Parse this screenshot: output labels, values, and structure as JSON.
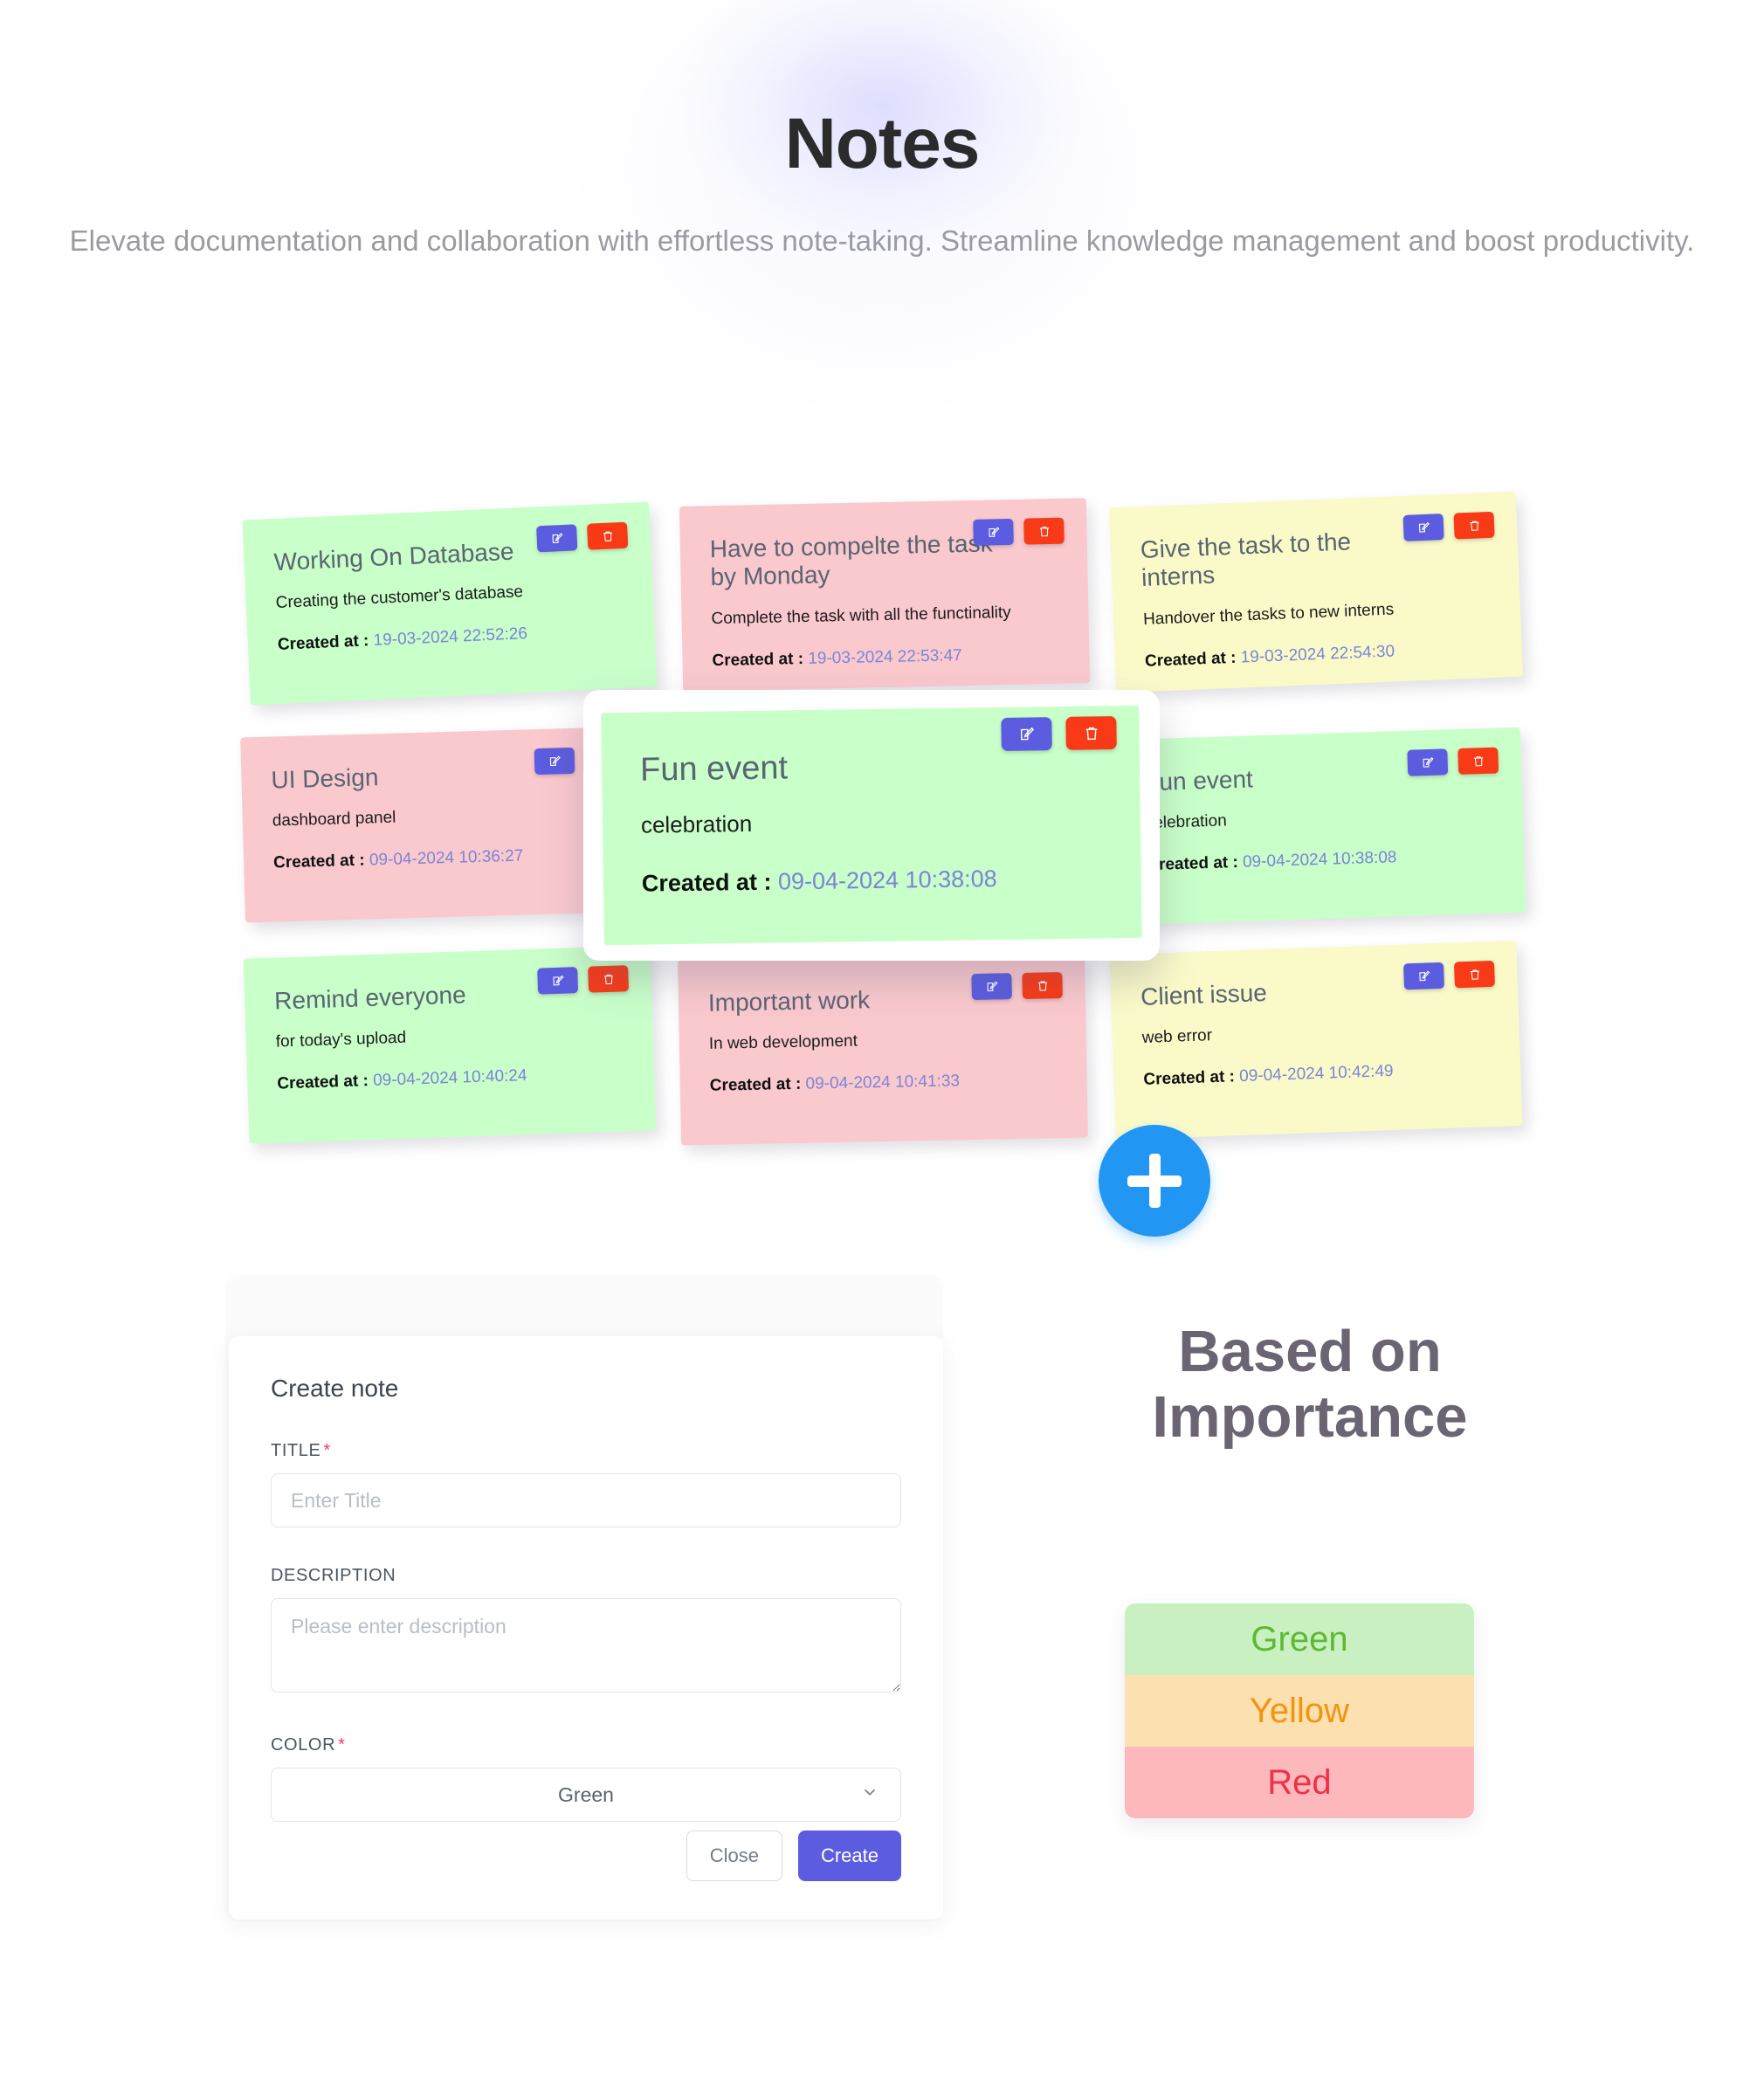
{
  "hero": {
    "title": "Notes",
    "subtitle": "Elevate documentation and collaboration with effortless note-taking. Streamline knowledge management and boost productivity."
  },
  "icons": {
    "edit": "edit-icon",
    "delete": "trash-icon",
    "add": "plus-icon",
    "chevron": "chevron-down-icon"
  },
  "labels": {
    "created_at": "Created at :"
  },
  "colors": {
    "green_card": "#c9ffc9",
    "pink_card": "#fac9ce",
    "yellow_card": "#fafac9",
    "edit_button": "#5c5ce0",
    "delete_button": "#f93a17",
    "fab": "#2196f3",
    "primary_button": "#5c5ce0"
  },
  "notes": [
    {
      "title": "Working On Database",
      "description": "Creating the customer's database",
      "created_at": "19-03-2024 22:52:26",
      "color": "green"
    },
    {
      "title": "Have to compelte the task by Monday",
      "description": "Complete the task with all the functinality",
      "created_at": "19-03-2024 22:53:47",
      "color": "pink"
    },
    {
      "title": "Give the task to the interns",
      "description": "Handover the tasks to new interns",
      "created_at": "19-03-2024 22:54:30",
      "color": "yellow"
    },
    {
      "title": "UI Design",
      "description": "dashboard panel",
      "created_at": "09-04-2024 10:36:27",
      "color": "pink"
    },
    {
      "title": "Fun event",
      "description": "celebration",
      "created_at": "09-04-2024 10:38:08",
      "color": "green"
    },
    {
      "title": "Fun event",
      "description": "celebration",
      "created_at": "09-04-2024 10:38:08",
      "color": "green"
    },
    {
      "title": "Remind everyone",
      "description": "for today's upload",
      "created_at": "09-04-2024 10:40:24",
      "color": "green"
    },
    {
      "title": "Important work",
      "description": "In web development",
      "created_at": "09-04-2024 10:41:33",
      "color": "pink"
    },
    {
      "title": "Client issue",
      "description": "web error",
      "created_at": "09-04-2024 10:42:49",
      "color": "yellow"
    }
  ],
  "modal_note": {
    "title": "Fun event",
    "description": "celebration",
    "created_at": "09-04-2024 10:38:08"
  },
  "form": {
    "heading": "Create note",
    "title_label": "TITLE",
    "title_placeholder": "Enter Title",
    "title_value": "",
    "description_label": "DESCRIPTION",
    "description_placeholder": "Please enter description",
    "description_value": "",
    "color_label": "COLOR",
    "color_selected": "Green",
    "close_button": "Close",
    "create_button": "Create"
  },
  "importance": {
    "heading": "Based on Importance",
    "rows": [
      {
        "label": "Green"
      },
      {
        "label": "Yellow"
      },
      {
        "label": "Red"
      }
    ]
  }
}
